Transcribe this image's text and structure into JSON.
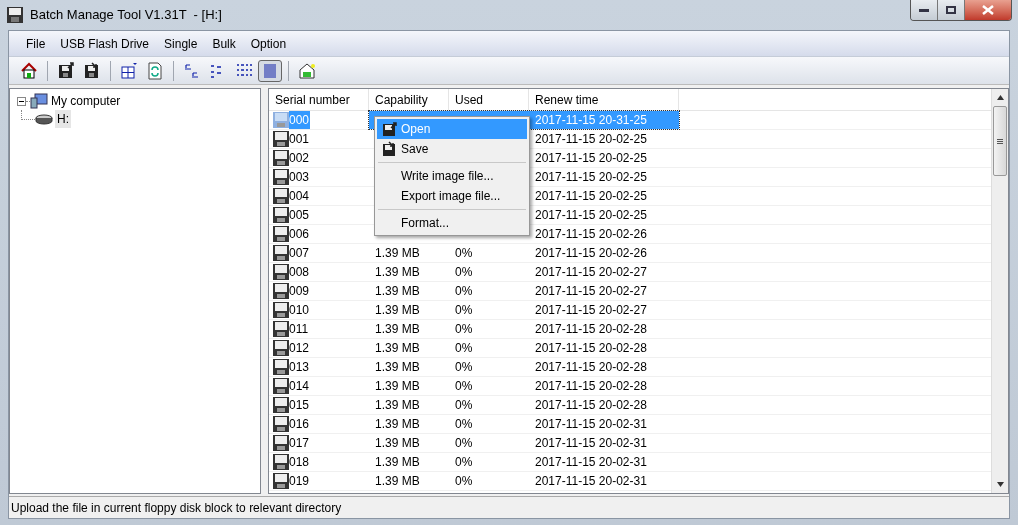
{
  "window": {
    "title": "Batch Manage Tool V1.31T  - [H:]"
  },
  "menu": [
    "File",
    "USB Flash Drive",
    "Single",
    "Bulk",
    "Option"
  ],
  "toolbar": [
    {
      "kind": "home",
      "pressed": false
    },
    {
      "kind": "sep"
    },
    {
      "kind": "save-out",
      "pressed": false
    },
    {
      "kind": "save-in",
      "pressed": false
    },
    {
      "kind": "sep"
    },
    {
      "kind": "grid",
      "pressed": false
    },
    {
      "kind": "refresh",
      "pressed": false
    },
    {
      "kind": "sep"
    },
    {
      "kind": "large",
      "pressed": false
    },
    {
      "kind": "small",
      "pressed": false
    },
    {
      "kind": "list",
      "pressed": false
    },
    {
      "kind": "details",
      "pressed": true
    },
    {
      "kind": "sep"
    },
    {
      "kind": "props",
      "pressed": false
    }
  ],
  "tree": {
    "label": "My computer",
    "expanded": true,
    "children": [
      {
        "label": "H:",
        "selected": true
      }
    ]
  },
  "table": {
    "columns": [
      "Serial number",
      "Capability",
      "Used",
      "Renew time"
    ],
    "rows": [
      {
        "serial": "000",
        "renew": "2017-11-15 20-31-25",
        "selected": true
      },
      {
        "serial": "001",
        "renew": "2017-11-15 20-02-25",
        "selected": false
      },
      {
        "serial": "002",
        "renew": "2017-11-15 20-02-25",
        "selected": false
      },
      {
        "serial": "003",
        "renew": "2017-11-15 20-02-25",
        "selected": false
      },
      {
        "serial": "004",
        "renew": "2017-11-15 20-02-25",
        "selected": false
      },
      {
        "serial": "005",
        "renew": "2017-11-15 20-02-25",
        "selected": false
      },
      {
        "serial": "006",
        "renew": "2017-11-15 20-02-26",
        "selected": false
      },
      {
        "serial": "007",
        "capability": "1.39 MB",
        "used": "0%",
        "renew": "2017-11-15 20-02-26",
        "selected": false
      },
      {
        "serial": "008",
        "capability": "1.39 MB",
        "used": "0%",
        "renew": "2017-11-15 20-02-27",
        "selected": false
      },
      {
        "serial": "009",
        "capability": "1.39 MB",
        "used": "0%",
        "renew": "2017-11-15 20-02-27",
        "selected": false
      },
      {
        "serial": "010",
        "capability": "1.39 MB",
        "used": "0%",
        "renew": "2017-11-15 20-02-27",
        "selected": false
      },
      {
        "serial": "011",
        "capability": "1.39 MB",
        "used": "0%",
        "renew": "2017-11-15 20-02-28",
        "selected": false
      },
      {
        "serial": "012",
        "capability": "1.39 MB",
        "used": "0%",
        "renew": "2017-11-15 20-02-28",
        "selected": false
      },
      {
        "serial": "013",
        "capability": "1.39 MB",
        "used": "0%",
        "renew": "2017-11-15 20-02-28",
        "selected": false
      },
      {
        "serial": "014",
        "capability": "1.39 MB",
        "used": "0%",
        "renew": "2017-11-15 20-02-28",
        "selected": false
      },
      {
        "serial": "015",
        "capability": "1.39 MB",
        "used": "0%",
        "renew": "2017-11-15 20-02-28",
        "selected": false
      },
      {
        "serial": "016",
        "capability": "1.39 MB",
        "used": "0%",
        "renew": "2017-11-15 20-02-31",
        "selected": false
      },
      {
        "serial": "017",
        "capability": "1.39 MB",
        "used": "0%",
        "renew": "2017-11-15 20-02-31",
        "selected": false
      },
      {
        "serial": "018",
        "capability": "1.39 MB",
        "used": "0%",
        "renew": "2017-11-15 20-02-31",
        "selected": false
      },
      {
        "serial": "019",
        "capability": "1.39 MB",
        "used": "0%",
        "renew": "2017-11-15 20-02-31",
        "selected": false
      }
    ]
  },
  "context_menu": [
    {
      "kind": "open",
      "label": "Open",
      "selected": true
    },
    {
      "kind": "save",
      "label": "Save",
      "selected": false
    },
    {
      "kind": "sep"
    },
    {
      "kind": "item",
      "label": "Write image file...",
      "selected": false
    },
    {
      "kind": "item",
      "label": "Export image file...",
      "selected": false
    },
    {
      "kind": "sep"
    },
    {
      "kind": "item",
      "label": "Format...",
      "selected": false
    }
  ],
  "status_bar": "Upload the file in current floppy disk block to relevant directory"
}
